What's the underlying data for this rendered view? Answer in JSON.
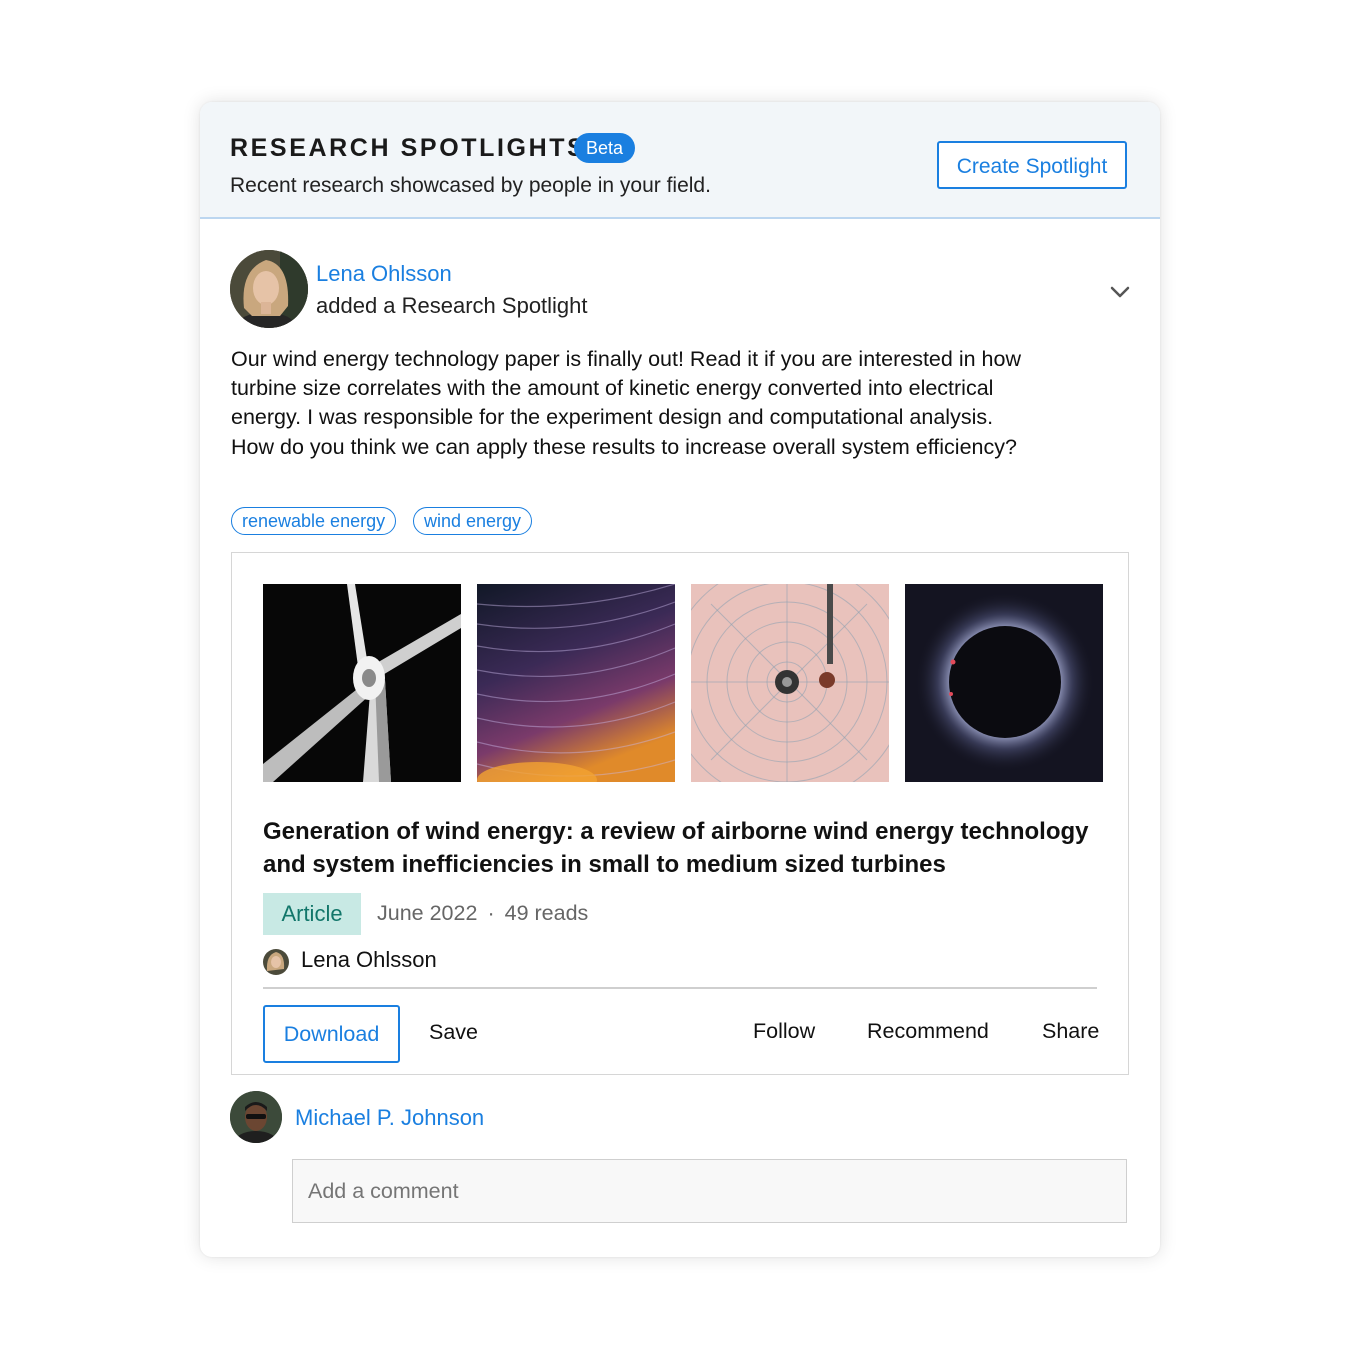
{
  "header": {
    "title": "RESEARCH SPOTLIGHTS",
    "badge": "Beta",
    "subtitle": "Recent research showcased by people in your field.",
    "create_button": "Create Spotlight"
  },
  "post": {
    "author": "Lena Ohlsson",
    "action": "added a Research Spotlight",
    "text": "Our wind energy technology paper is finally out! Read it if you are interested in how turbine size correlates with the amount of kinetic energy converted into electrical energy. I was responsible for the experiment design and computational analysis. How do you think we can apply these results to increase overall system efficiency?",
    "tags": [
      "renewable energy",
      "wind energy"
    ],
    "menu_icon": "chevron-down-icon"
  },
  "publication": {
    "images": [
      "wind-turbine",
      "star-trails",
      "chart-recorder",
      "solar-eclipse"
    ],
    "title": "Generation of wind energy: a review of airborne wind energy technology and system inefficiencies in small to medium sized turbines",
    "type": "Article",
    "date": "June 2022",
    "separator": "·",
    "reads": "49 reads",
    "author": "Lena Ohlsson",
    "actions": {
      "download": "Download",
      "save": "Save",
      "follow": "Follow",
      "recommend": "Recommend",
      "share": "Share"
    }
  },
  "comment": {
    "user": "Michael P. Johnson",
    "placeholder": "Add a comment"
  },
  "colors": {
    "accent": "#1a7fe0",
    "header_bg": "#f2f6f9",
    "article_badge_bg": "#c8e9e4",
    "article_badge_text": "#12766a"
  }
}
